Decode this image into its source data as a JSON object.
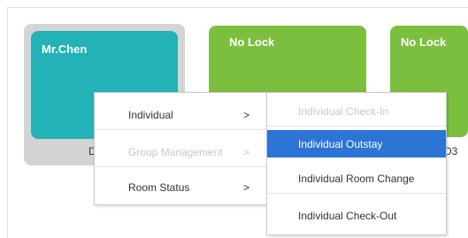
{
  "rooms": [
    {
      "label": "Mr.Chen",
      "number_fragment": "D",
      "color": "#22b2b7",
      "state": "selected"
    },
    {
      "label": "No Lock",
      "number_fragment": "",
      "color": "#7cbf3f"
    },
    {
      "label": "No Lock",
      "number_fragment": "D3",
      "color": "#7cbf3f"
    }
  ],
  "context_menu": {
    "items": [
      {
        "label": "Individual",
        "arrow": ">",
        "enabled": true
      },
      {
        "label": "Group Management",
        "arrow": ">",
        "enabled": false
      },
      {
        "label": "Room Status",
        "arrow": ">",
        "enabled": true
      }
    ]
  },
  "submenu": {
    "items": [
      {
        "label": "Individual Check-In",
        "enabled": false
      },
      {
        "label": "Individual Outstay",
        "enabled": true,
        "highlighted": true
      },
      {
        "label": "Individual Room Change",
        "enabled": true
      },
      {
        "label": "Individual Check-Out",
        "enabled": true
      }
    ]
  },
  "colors": {
    "highlight": "#2c74d6",
    "teal": "#22b2b7",
    "green": "#7cbf3f",
    "selection_bg": "#d4d4d4"
  }
}
